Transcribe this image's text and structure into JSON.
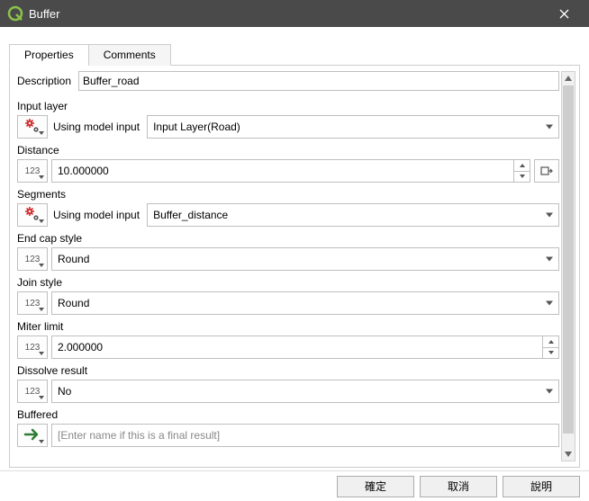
{
  "window": {
    "title": "Buffer"
  },
  "tabs": {
    "properties": "Properties",
    "comments": "Comments"
  },
  "description": {
    "label": "Description",
    "value": "Buffer_road"
  },
  "fields": {
    "input_layer": {
      "label": "Input layer",
      "mode": "Using model input",
      "value": "Input Layer(Road)",
      "type_icon": "gears"
    },
    "distance": {
      "label": "Distance",
      "value": "10.000000",
      "type_icon": "123"
    },
    "segments": {
      "label": "Segments",
      "mode": "Using model input",
      "value": "Buffer_distance",
      "type_icon": "gears"
    },
    "end_cap": {
      "label": "End cap style",
      "value": "Round",
      "type_icon": "123"
    },
    "join_style": {
      "label": "Join style",
      "value": "Round",
      "type_icon": "123"
    },
    "miter_limit": {
      "label": "Miter limit",
      "value": "2.000000",
      "type_icon": "123"
    },
    "dissolve": {
      "label": "Dissolve result",
      "value": "No",
      "type_icon": "123"
    },
    "buffered": {
      "label": "Buffered",
      "placeholder": "[Enter name if this is a final result]",
      "type_icon": "arrow"
    }
  },
  "buttons": {
    "ok": "確定",
    "cancel": "取消",
    "help": "說明"
  },
  "type_label_123": "123"
}
